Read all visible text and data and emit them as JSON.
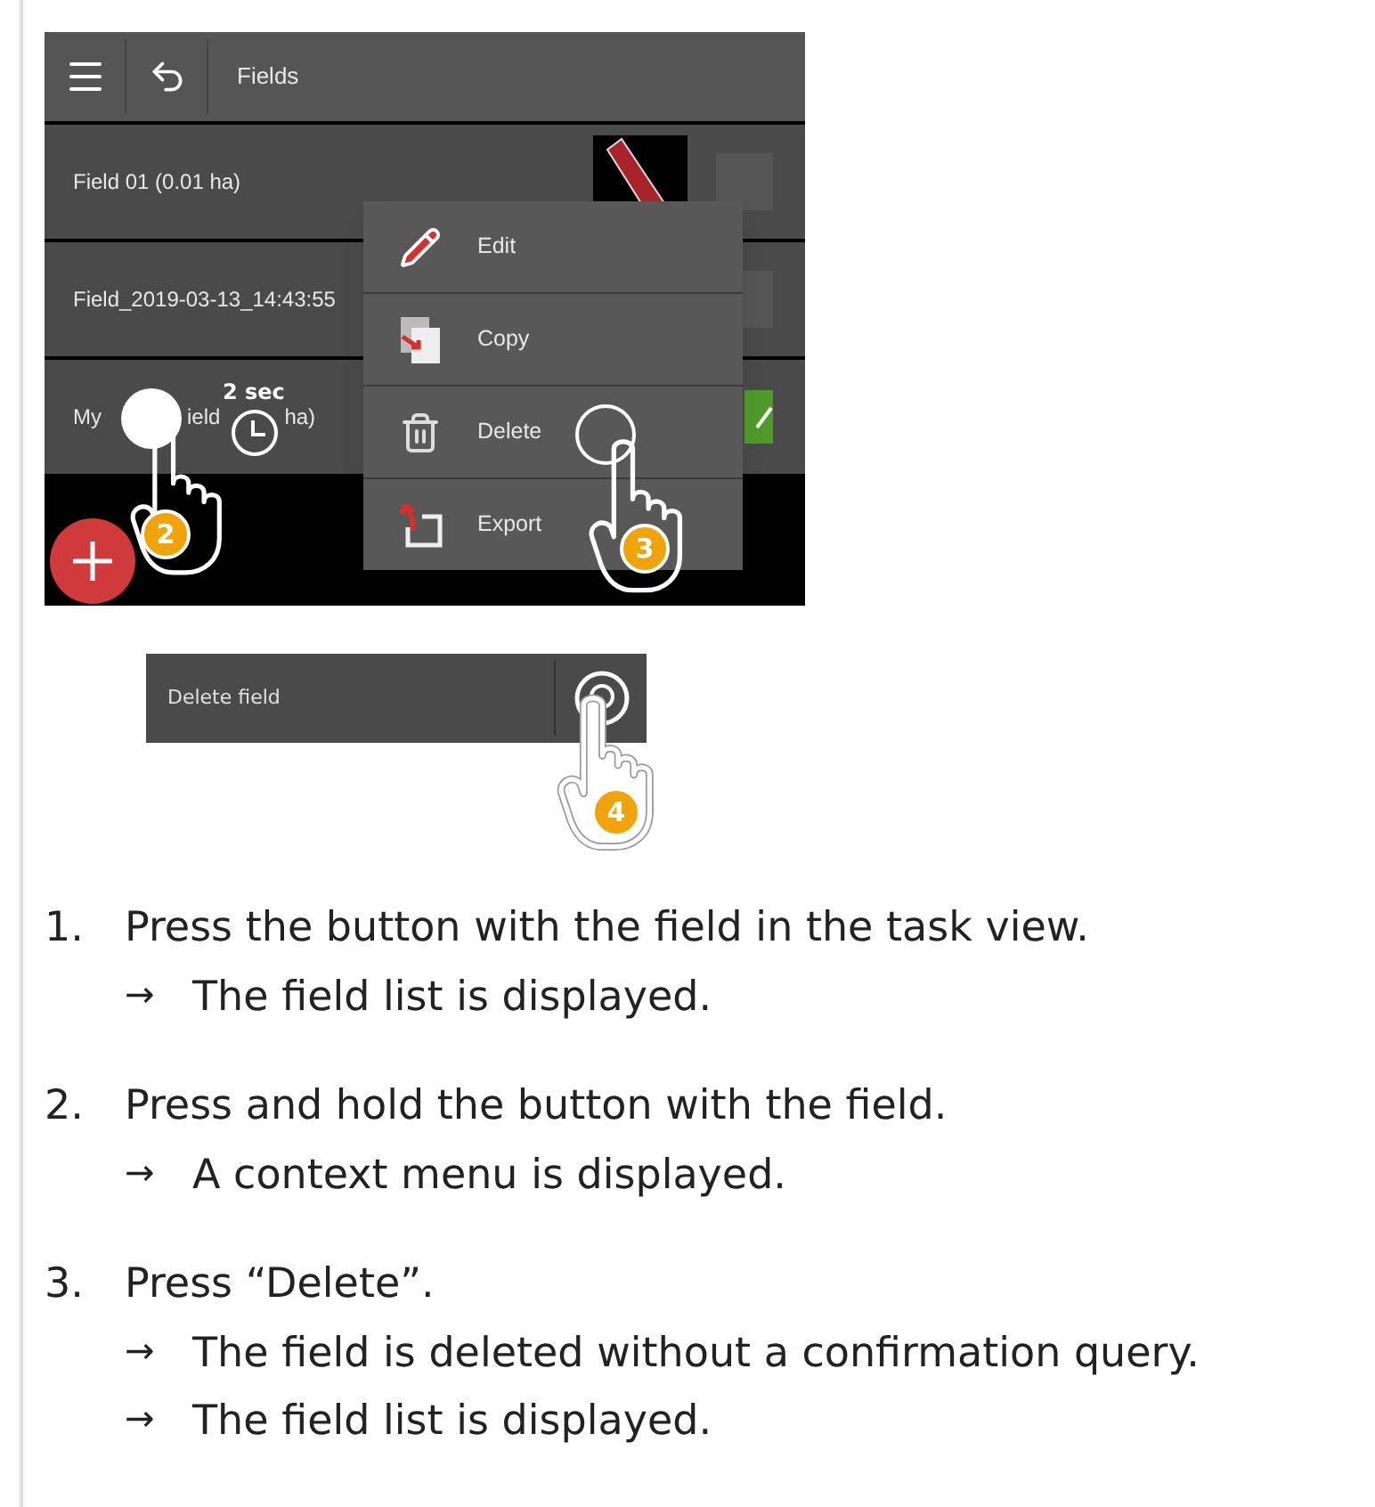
{
  "app": {
    "title": "Fields",
    "fields": [
      {
        "kind": "thumbnail",
        "label": "Field 01 (0.01 ha)"
      },
      {
        "kind": "plain",
        "label": "Field_2019-03-13_14:43:55"
      },
      {
        "kind": "active",
        "fragments": [
          "My",
          "ield",
          "ha)"
        ]
      }
    ],
    "context_menu": [
      {
        "kind": "edit",
        "label": "Edit"
      },
      {
        "kind": "copy",
        "label": "Copy"
      },
      {
        "kind": "delete",
        "label": "Delete"
      },
      {
        "kind": "export",
        "label": "Export"
      }
    ],
    "hold_time": "2 sec",
    "markers": [
      "2",
      "3"
    ]
  },
  "dialog": {
    "label": "Delete field",
    "marker": "4"
  },
  "steps": [
    {
      "number": "1.",
      "text": "Press the button with the field in the task view.",
      "results": [
        "The field list is displayed."
      ]
    },
    {
      "number": "2.",
      "text": "Press and hold the button with the field.",
      "results": [
        "A context menu is displayed."
      ]
    },
    {
      "number": "3.",
      "text": "Press “Delete”.",
      "results": [
        "The field is deleted without a confirmation query.",
        "The field list is displayed."
      ]
    }
  ],
  "result_arrow": "→"
}
